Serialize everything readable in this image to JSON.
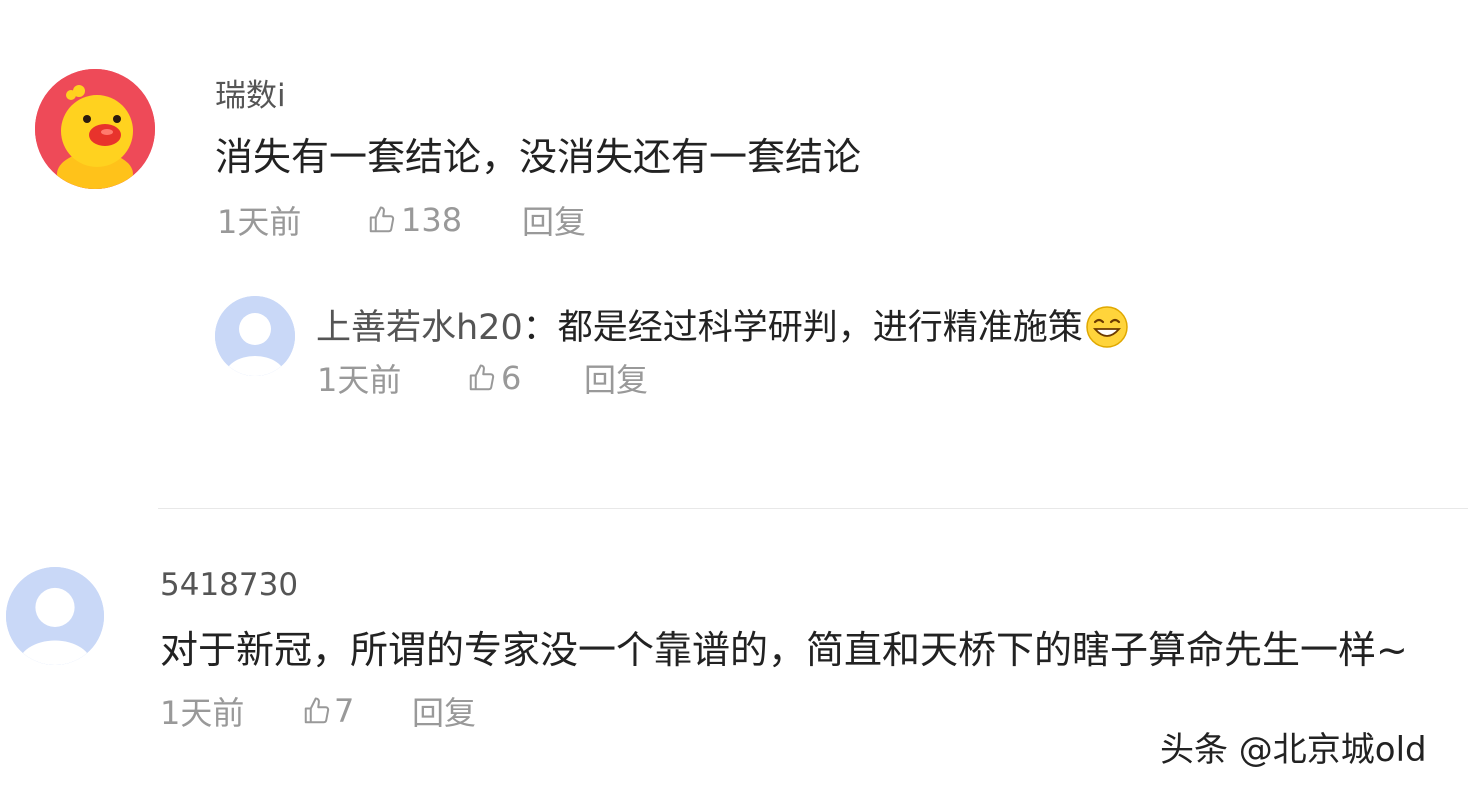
{
  "comments": [
    {
      "username": "瑞数i",
      "text": "消失有一套结论，没消失还有一套结论",
      "time": "1天前",
      "likes": "138",
      "reply_label": "回复",
      "avatar": "yellow-duck-avatar",
      "replies": [
        {
          "username": "上善若水h20",
          "separator": "：",
          "text": "都是经过科学研判，进行精准施策",
          "emoji": "grin-emoji",
          "time": "1天前",
          "likes": "6",
          "reply_label": "回复",
          "avatar": "default-avatar"
        }
      ]
    },
    {
      "username": "5418730",
      "text": "对于新冠，所谓的专家没一个靠谱的，简直和天桥下的瞎子算命先生一样~",
      "time": "1天前",
      "likes": "7",
      "reply_label": "回复",
      "avatar": "default-avatar"
    }
  ],
  "watermark": "头条 @北京城old",
  "colors": {
    "text": "#222222",
    "username": "#555555",
    "meta": "#999999",
    "avatar_default": "#c9d8f7",
    "avatar_red": "#ee4a58"
  }
}
